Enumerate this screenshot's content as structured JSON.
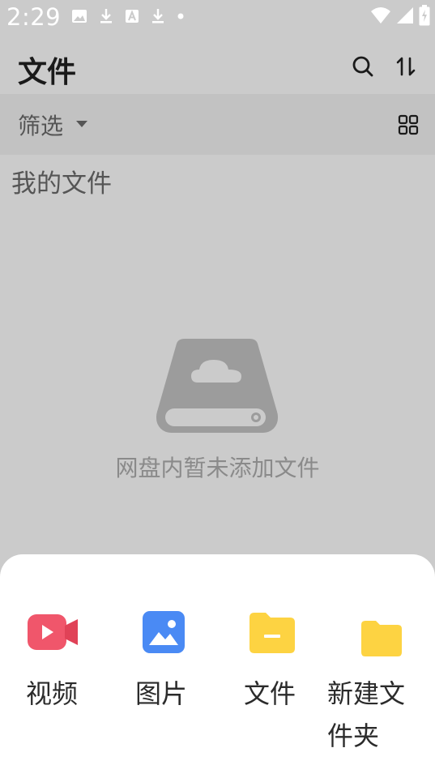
{
  "status_bar": {
    "time": "2:29",
    "left_icons": [
      "image-notification-icon",
      "download-icon",
      "font-a-icon",
      "download-icon",
      "dot-icon"
    ],
    "right_icons": [
      "wifi-icon",
      "signal-icon",
      "battery-charging-icon"
    ]
  },
  "app_bar": {
    "title": "文件",
    "actions": [
      "search-icon",
      "sort-icon"
    ]
  },
  "filter_bar": {
    "label": "筛选",
    "view_toggle": "grid-view-icon"
  },
  "section": {
    "title": "我的文件"
  },
  "empty_state": {
    "icon": "cloud-drive-icon",
    "message": "网盘内暂未添加文件"
  },
  "bottom_sheet": {
    "actions": [
      {
        "label": "视频",
        "icon": "video-camera-icon",
        "color": "#f0566b"
      },
      {
        "label": "图片",
        "icon": "picture-icon",
        "color": "#4a8af4"
      },
      {
        "label": "文件",
        "icon": "file-folder-icon",
        "color": "#fdd342"
      },
      {
        "label_line1": "新建文",
        "label_line2": "件夹",
        "icon": "new-folder-icon",
        "color": "#fdd342"
      }
    ]
  },
  "colors": {
    "dim_overlay_background": "#cbcbcb",
    "filter_bar_background": "#c2c2c2",
    "sheet_background": "#ffffff"
  }
}
